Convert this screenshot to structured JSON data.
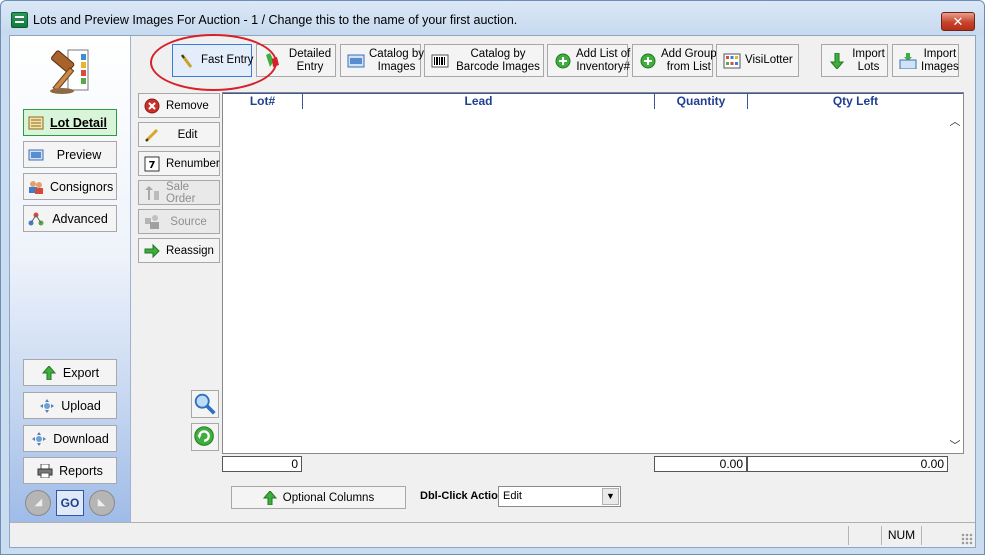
{
  "window": {
    "title": "Lots and Preview Images For Auction  -  1 / Change this to the name of your first auction.",
    "close_label": "✕"
  },
  "nav": {
    "items": [
      {
        "label": "Lot Detail",
        "icon": "lot-detail-icon",
        "active": true
      },
      {
        "label": "Preview",
        "icon": "preview-icon"
      },
      {
        "label": "Consignors",
        "icon": "consignors-icon"
      },
      {
        "label": "Advanced",
        "icon": "advanced-icon"
      }
    ],
    "bottom": [
      {
        "label": "Export",
        "icon": "export-arrow-icon"
      },
      {
        "label": "Upload",
        "icon": "upload-icon"
      },
      {
        "label": "Download",
        "icon": "download-icon"
      },
      {
        "label": "Reports",
        "icon": "printer-icon"
      }
    ],
    "go_label": "GO"
  },
  "toolbar": {
    "fast_entry": "Fast Entry",
    "detailed_entry_1": "Detailed",
    "detailed_entry_2": "Entry",
    "catalog_images_1": "Catalog by",
    "catalog_images_2": "Images",
    "catalog_barcode_1": "Catalog by",
    "catalog_barcode_2": "Barcode Images",
    "add_list_1": "Add List of",
    "add_list_2": "Inventory#",
    "add_group_1": "Add Group",
    "add_group_2": "from List",
    "visilotter": "VisiLotter",
    "import_lots_1": "Import",
    "import_lots_2": "Lots",
    "import_images_1": "Import",
    "import_images_2": "Images"
  },
  "actions": [
    {
      "label": "Remove",
      "enabled": true
    },
    {
      "label": "Edit",
      "enabled": true
    },
    {
      "label": "Renumber",
      "enabled": true
    },
    {
      "label": "Sale Order",
      "enabled": false
    },
    {
      "label": "Source",
      "enabled": false
    },
    {
      "label": "Reassign",
      "enabled": true
    }
  ],
  "grid": {
    "columns": [
      "Lot#",
      "Lead",
      "Quantity",
      "Qty Left"
    ],
    "totals": {
      "lot": "0",
      "quantity": "0.00",
      "qty_left": "0.00"
    }
  },
  "bottom": {
    "optional_columns": "Optional Columns",
    "dbl_click_label": "Dbl-Click Action",
    "dbl_click_value": "Edit"
  },
  "status": {
    "num": "NUM"
  },
  "colors": {
    "highlight": "#d7212a",
    "header_text": "#1f3f8f",
    "active_nav": "#2f9a40"
  }
}
